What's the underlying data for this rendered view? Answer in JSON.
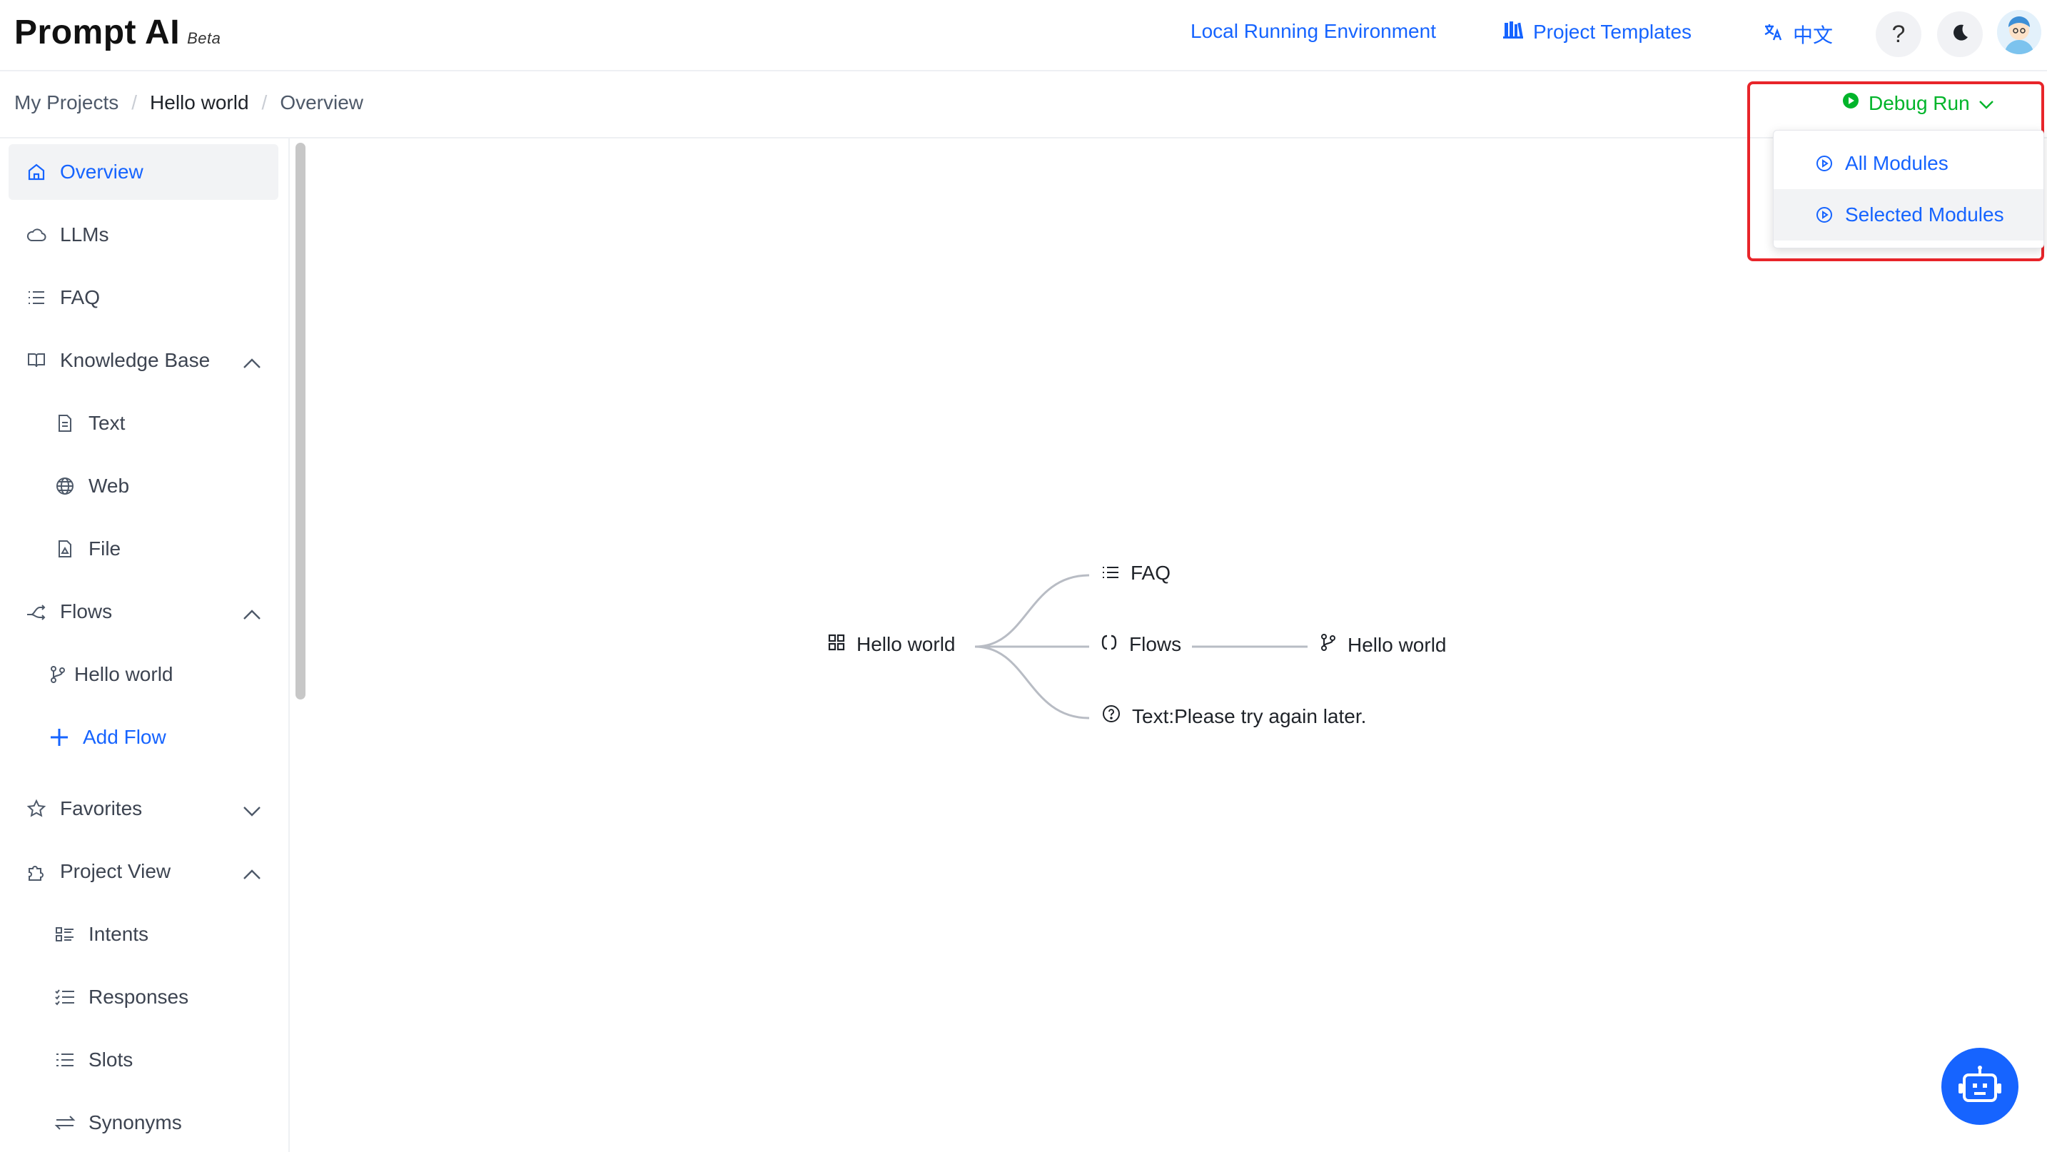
{
  "app": {
    "name": "Prompt AI",
    "badge": "Beta"
  },
  "header": {
    "local_env": "Local Running Environment",
    "templates": "Project Templates",
    "language": "中文"
  },
  "breadcrumb": [
    "My Projects",
    "Hello world",
    "Overview"
  ],
  "sidebar": {
    "items": [
      {
        "label": "Overview",
        "icon": "home-icon"
      },
      {
        "label": "LLMs",
        "icon": "cloud-icon"
      },
      {
        "label": "FAQ",
        "icon": "list-icon"
      },
      {
        "label": "Knowledge Base",
        "icon": "book-icon"
      },
      {
        "label": "Text",
        "icon": "document-icon"
      },
      {
        "label": "Web",
        "icon": "globe-icon"
      },
      {
        "label": "File",
        "icon": "file-icon"
      },
      {
        "label": "Flows",
        "icon": "flows-icon"
      },
      {
        "label": "Hello world",
        "icon": "branch-icon"
      },
      {
        "label": "Add Flow",
        "icon": "plus-icon"
      },
      {
        "label": "Favorites",
        "icon": "star-icon"
      },
      {
        "label": "Project View",
        "icon": "puzzle-icon"
      },
      {
        "label": "Intents",
        "icon": "intents-icon"
      },
      {
        "label": "Responses",
        "icon": "responses-icon"
      },
      {
        "label": "Slots",
        "icon": "slots-icon"
      },
      {
        "label": "Synonyms",
        "icon": "synonyms-icon"
      }
    ]
  },
  "debug": {
    "button": "Debug Run",
    "menu": [
      "All Modules",
      "Selected Modules"
    ]
  },
  "mindmap": {
    "root": "Hello world",
    "faq": "FAQ",
    "flows": "Flows",
    "flow_child": "Hello world",
    "fallback": "Text:Please try again later."
  },
  "colors": {
    "accent": "#1664ff",
    "debug": "#00b42a",
    "highlight": "#e8252a"
  }
}
